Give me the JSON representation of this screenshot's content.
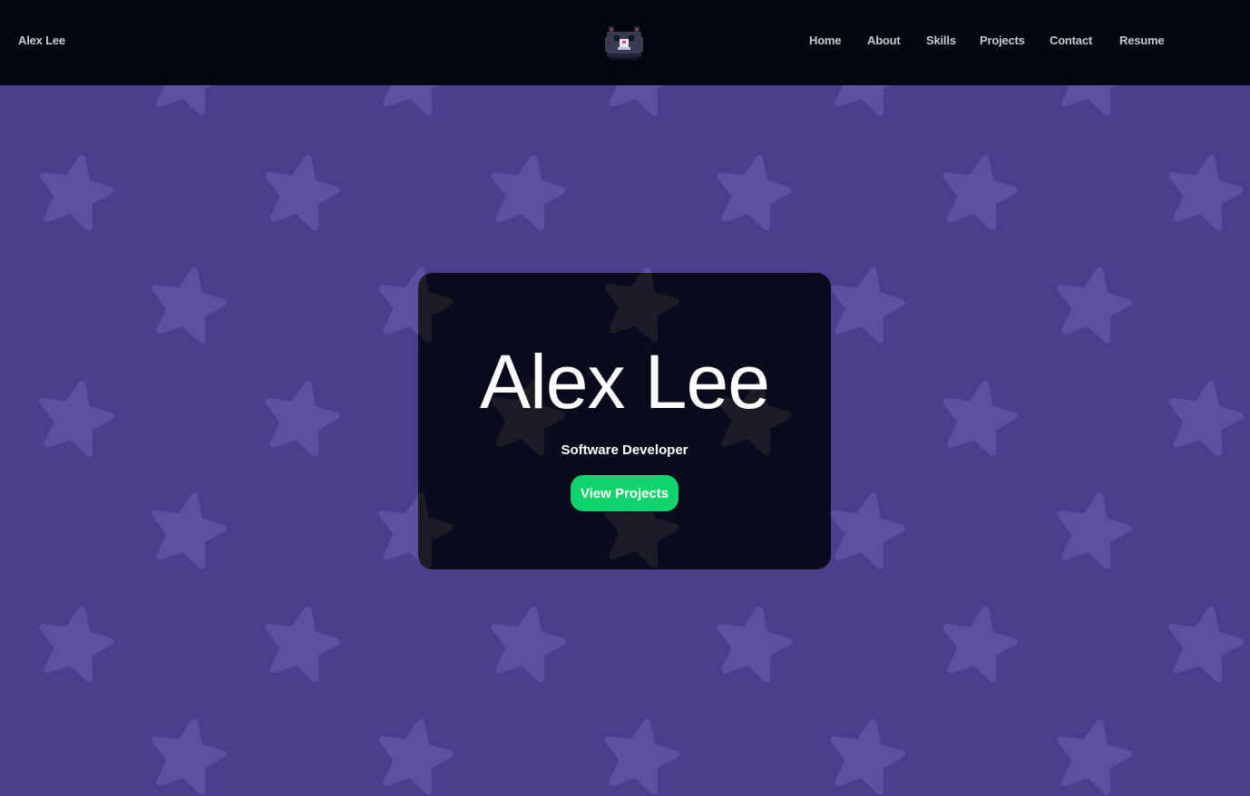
{
  "navbar": {
    "brand": "Alex Lee",
    "logo_icon": "pixel-cat-logo-icon",
    "links": [
      {
        "label": "Home"
      },
      {
        "label": "About"
      },
      {
        "label": "Skills"
      },
      {
        "label": "Projects"
      },
      {
        "label": "Contact"
      },
      {
        "label": "Resume"
      }
    ]
  },
  "hero": {
    "title": "Alex Lee",
    "subtitle": "Software Developer",
    "cta_label": "View Projects",
    "background_pattern_icon": "star-icon"
  },
  "colors": {
    "navbar_bg": "#03050f",
    "hero_bg": "#4a3d8b",
    "star": "#5c50a0",
    "card_bg": "#02040e",
    "cta_bg": "#11d36d",
    "nav_text": "#c9cad1"
  }
}
